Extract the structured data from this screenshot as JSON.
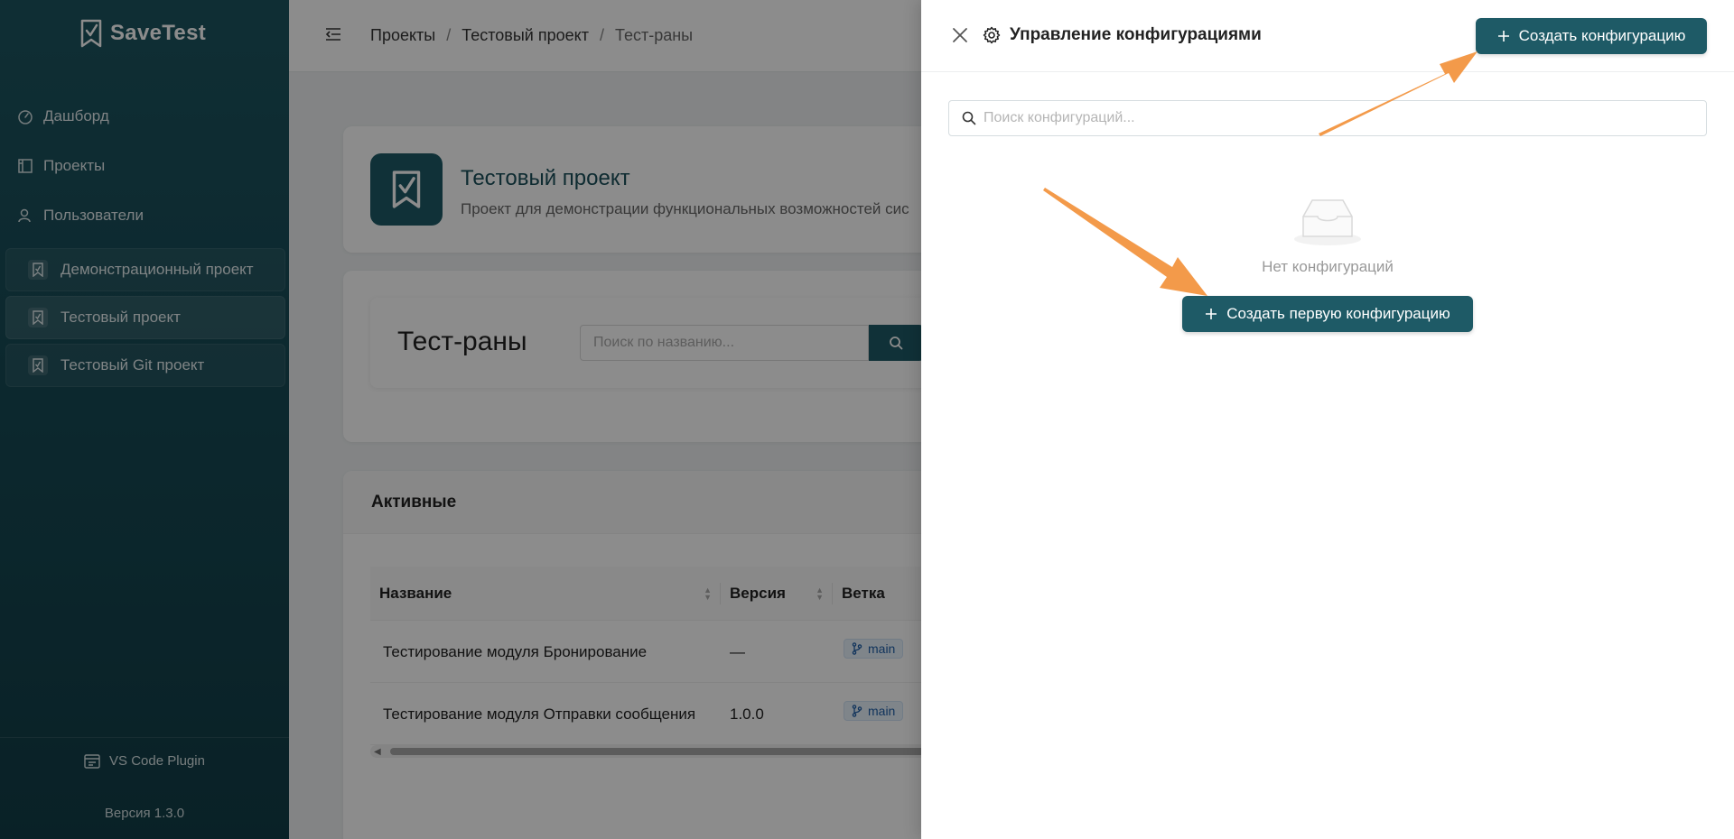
{
  "app": {
    "name": "SaveTest"
  },
  "sidebar": {
    "nav": [
      {
        "label": "Дашборд",
        "icon": "dashboard-icon"
      },
      {
        "label": "Проекты",
        "icon": "projects-icon"
      },
      {
        "label": "Пользователи",
        "icon": "users-icon"
      }
    ],
    "projects": [
      {
        "label": "Демонстрационный проект",
        "active": false
      },
      {
        "label": "Тестовый проект",
        "active": true
      },
      {
        "label": "Тестовый Git проект",
        "active": false
      }
    ],
    "vscode_label": "VS Code Plugin",
    "version": "Версия 1.3.0"
  },
  "breadcrumb": [
    "Проекты",
    "Тестовый проект",
    "Тест-раны"
  ],
  "project": {
    "title": "Тестовый проект",
    "description": "Проект для демонстрации функциональных возможностей сис"
  },
  "runs": {
    "title": "Тест-раны",
    "search_placeholder": "Поиск по названию..."
  },
  "active": {
    "title": "Активные",
    "columns": [
      "Название",
      "Версия",
      "Ветка"
    ],
    "rows": [
      {
        "name": "Тестирование модуля Бронирование",
        "version": "—",
        "branch": "main"
      },
      {
        "name": "Тестирование модуля Отправки сообщения",
        "version": "1.0.0",
        "branch": "main"
      }
    ]
  },
  "drawer": {
    "title": "Управление конфигурациями",
    "create_label": "Создать конфигурацию",
    "search_placeholder": "Поиск конфигураций...",
    "search_value": "",
    "empty_text": "Нет конфигураций",
    "create_first_label": "Создать первую конфигурацию"
  },
  "colors": {
    "primary": "#1e5a66",
    "sidebar_top": "#1d5560",
    "sidebar_bottom": "#123d47",
    "annotation_arrow": "#f39a4a",
    "branch_tag_text": "#1f5fa8"
  }
}
